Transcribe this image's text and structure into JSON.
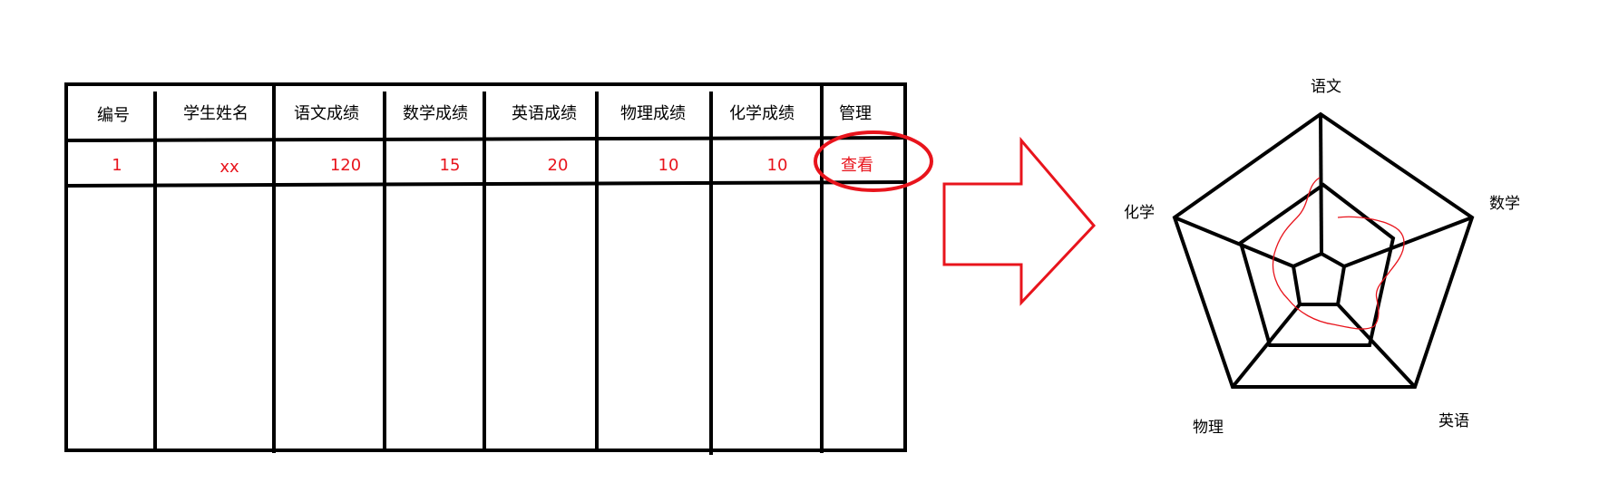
{
  "table": {
    "headers": [
      "编号",
      "学生姓名",
      "语文成绩",
      "数学成绩",
      "英语成绩",
      "物理成绩",
      "化学成绩",
      "管理"
    ],
    "rows": [
      [
        "1",
        "xx",
        "120",
        "15",
        "20",
        "10",
        "10",
        "查看"
      ]
    ],
    "action_label": "查看"
  },
  "radar": {
    "axes": [
      "语文",
      "数学",
      "英语",
      "物理",
      "化学"
    ]
  },
  "colors": {
    "ink": "#000000",
    "accent": "#e8141c"
  }
}
